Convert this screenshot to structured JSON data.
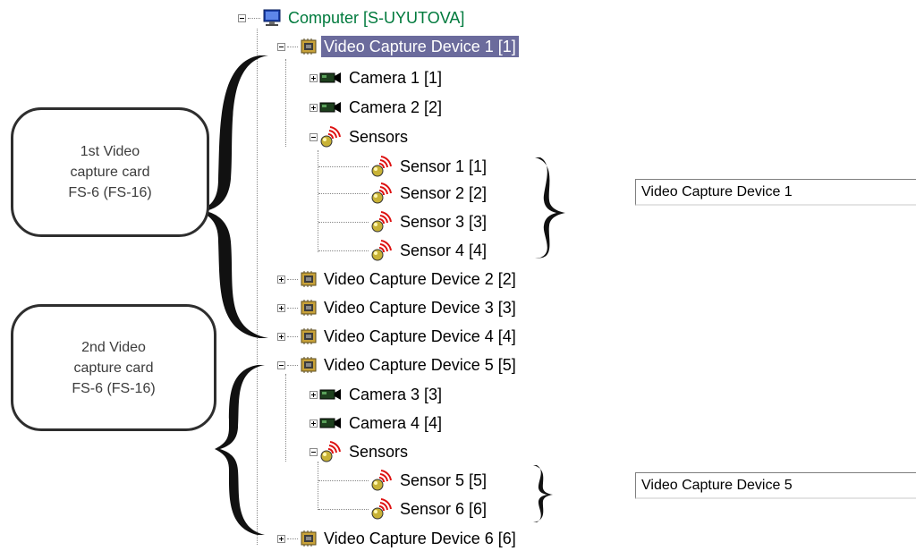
{
  "tree": {
    "root": "Computer [S-UYUTOVA]",
    "device1": "Video Capture Device 1 [1]",
    "camera1": "Camera 1 [1]",
    "camera2": "Camera 2 [2]",
    "sensors_group_1": "Sensors",
    "sensor1": "Sensor 1 [1]",
    "sensor2": "Sensor 2 [2]",
    "sensor3": "Sensor 3 [3]",
    "sensor4": "Sensor 4 [4]",
    "device2": "Video Capture Device 2 [2]",
    "device3": "Video Capture Device 3 [3]",
    "device4": "Video Capture Device 4 [4]",
    "device5": "Video Capture Device 5 [5]",
    "camera3": "Camera 3 [3]",
    "camera4": "Camera 4 [4]",
    "sensors_group_2": "Sensors",
    "sensor5": "Sensor 5 [5]",
    "sensor6": "Sensor 6 [6]",
    "device6": "Video Capture Device 6 [6]"
  },
  "callouts": {
    "card1": [
      "1st Video",
      "capture card",
      "FS-6 (FS-16)"
    ],
    "card2": [
      "2nd Video",
      "capture card",
      "FS-6 (FS-16)"
    ]
  },
  "fields": {
    "device1": "Video Capture Device 1",
    "device5": "Video Capture Device 5"
  },
  "colors": {
    "selection": "#6b6b9c",
    "root_label": "#007a3d",
    "outline": "#2e2e2e"
  },
  "icons": [
    "monitor-icon",
    "capture-card-icon",
    "camera-icon",
    "sensor-icon"
  ]
}
